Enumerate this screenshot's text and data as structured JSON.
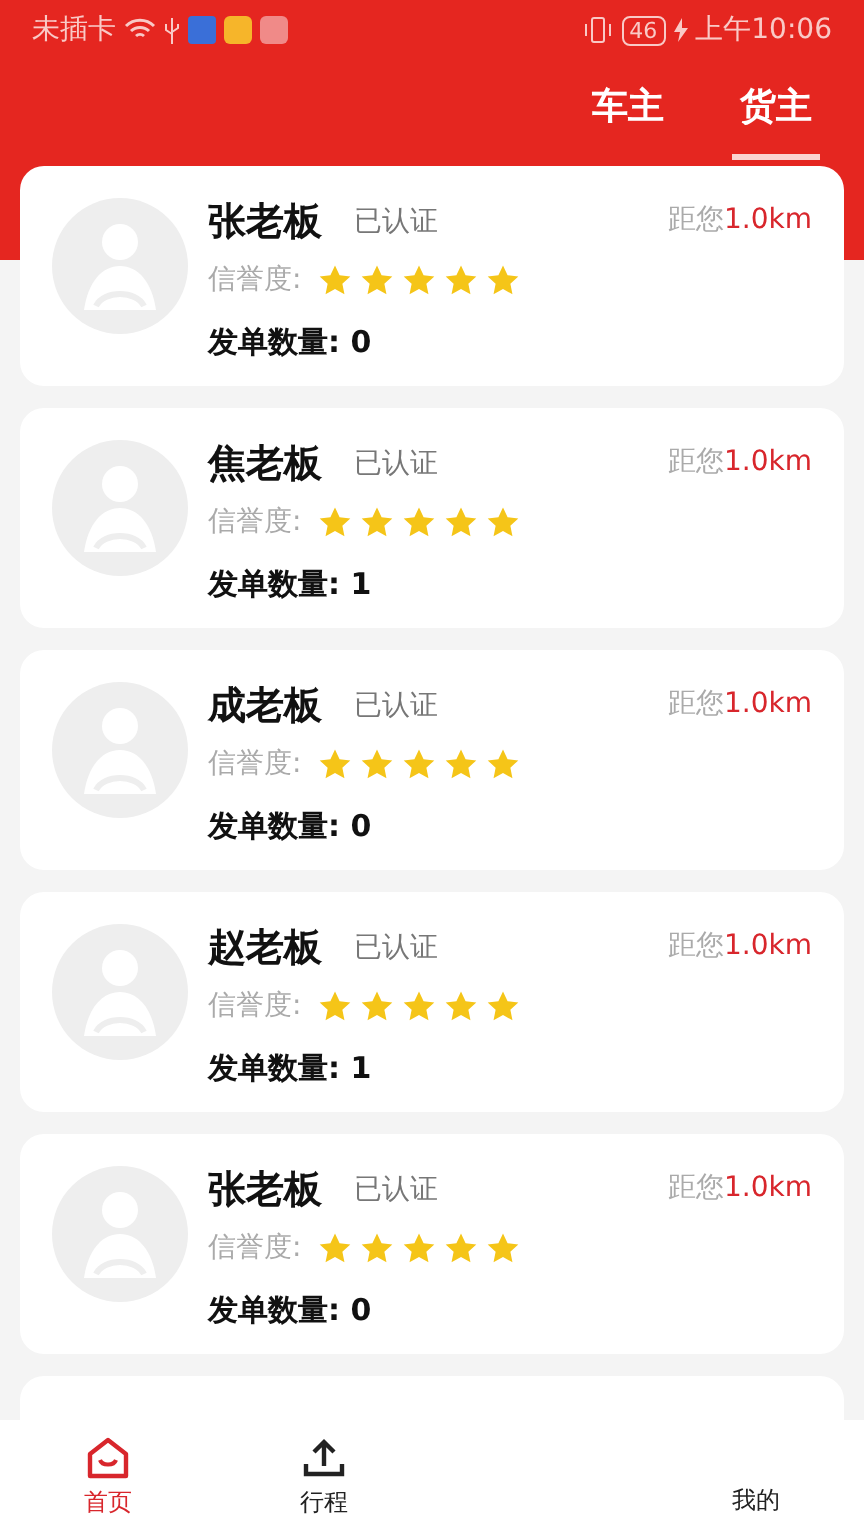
{
  "status_bar": {
    "carrier": "未插卡",
    "battery": "46",
    "time": "上午10:06"
  },
  "tabs": [
    {
      "label": "车主",
      "selected": false
    },
    {
      "label": "货主",
      "selected": true
    }
  ],
  "owners": [
    {
      "name": "张老板",
      "verified": "已认证",
      "distance_label": "距您",
      "distance": "1.0km",
      "rating_label": "信誉度:",
      "stars": 5,
      "orders_label": "发单数量:",
      "orders": "0"
    },
    {
      "name": "焦老板",
      "verified": "已认证",
      "distance_label": "距您",
      "distance": "1.0km",
      "rating_label": "信誉度:",
      "stars": 5,
      "orders_label": "发单数量:",
      "orders": "1"
    },
    {
      "name": "成老板",
      "verified": "已认证",
      "distance_label": "距您",
      "distance": "1.0km",
      "rating_label": "信誉度:",
      "stars": 5,
      "orders_label": "发单数量:",
      "orders": "0"
    },
    {
      "name": "赵老板",
      "verified": "已认证",
      "distance_label": "距您",
      "distance": "1.0km",
      "rating_label": "信誉度:",
      "stars": 5,
      "orders_label": "发单数量:",
      "orders": "1"
    },
    {
      "name": "张老板",
      "verified": "已认证",
      "distance_label": "距您",
      "distance": "1.0km",
      "rating_label": "信誉度:",
      "stars": 5,
      "orders_label": "发单数量:",
      "orders": "0"
    }
  ],
  "bottom_nav": [
    {
      "label": "首页",
      "kind": "home",
      "selected": true
    },
    {
      "label": "行程",
      "kind": "trips",
      "selected": false
    },
    {
      "label": "我的",
      "kind": "mine",
      "selected": false
    }
  ]
}
